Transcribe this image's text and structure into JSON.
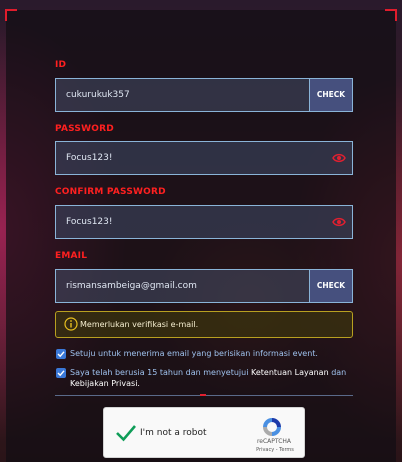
{
  "form": {
    "id_label": "ID",
    "id_value": "cukurukuk357",
    "id_check": "CHECK",
    "password_label": "PASSWORD",
    "password_value": "Focus123!",
    "confirm_label": "CONFIRM PASSWORD",
    "confirm_value": "Focus123!",
    "email_label": "EMAIL",
    "email_value": "rismansambeiga@gmail.com",
    "email_check": "CHECK",
    "notice": "Memerlukan verifikasi e-mail.",
    "consent_email": "Setuju untuk menerima email yang berisikan informasi event.",
    "consent_age_prefix": "Saya telah berusia 15 tahun dan menyetujui",
    "consent_tos": "Ketentuan Layanan",
    "consent_and": "dan",
    "consent_privacy": "Kebijakan Privasi."
  },
  "recaptcha": {
    "label": "I'm not a robot",
    "brand": "reCAPTCHA",
    "links": "Privacy - Terms"
  },
  "colors": {
    "label_red": "#ff2020",
    "field_border": "#8ab4d8",
    "check_bg": "#46507e",
    "notice_border": "#b8a020",
    "checkbox_blue": "#3a78d8",
    "recaptcha_green": "#0f9d58"
  },
  "icons": {
    "eye": "eye-icon",
    "info": "info-icon",
    "check": "checkmark-icon",
    "recaptcha": "recaptcha-logo-icon"
  }
}
